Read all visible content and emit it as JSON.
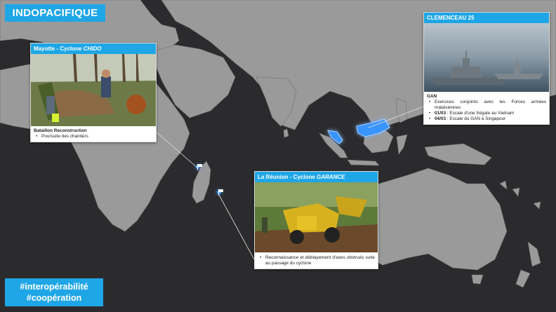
{
  "page": {
    "title": "INDOPACIFIQUE",
    "hashtags": [
      "#interopérabilité",
      "#coopération"
    ]
  },
  "cards": {
    "mayotte": {
      "header_prefix": "Mayotte - Cyclone ",
      "header_italic": "CHIDO",
      "section": "Bataillon Reconstruction",
      "bullets": [
        "Poursuite des chantiers"
      ]
    },
    "clemenceau": {
      "header": "CLEMENCEAU 25",
      "section": "GAN",
      "bullets": [
        {
          "bold": "",
          "text": "Exercices conjoints avec les Forces armées malaisiennes"
        },
        {
          "bold": "01/03",
          "text": " : Escale d'une frégate au Vietnam"
        },
        {
          "bold": "04/03",
          "text": " : Escale du GAN à Singapour"
        }
      ]
    },
    "reunion": {
      "header_prefix": "La Réunion - Cyclone ",
      "header_italic": "GARANCE",
      "bullets": [
        "Reconnaissance et déblayement d'axes obstrués suite au passage du cyclone"
      ]
    }
  },
  "colors": {
    "accent": "#1ea6e6",
    "land": "#9b9b9b",
    "sea": "#2b2b2d",
    "highlight_glow": "#2a8cff"
  },
  "icons": [
    "flag-marker-icon",
    "flag-marker-icon"
  ]
}
